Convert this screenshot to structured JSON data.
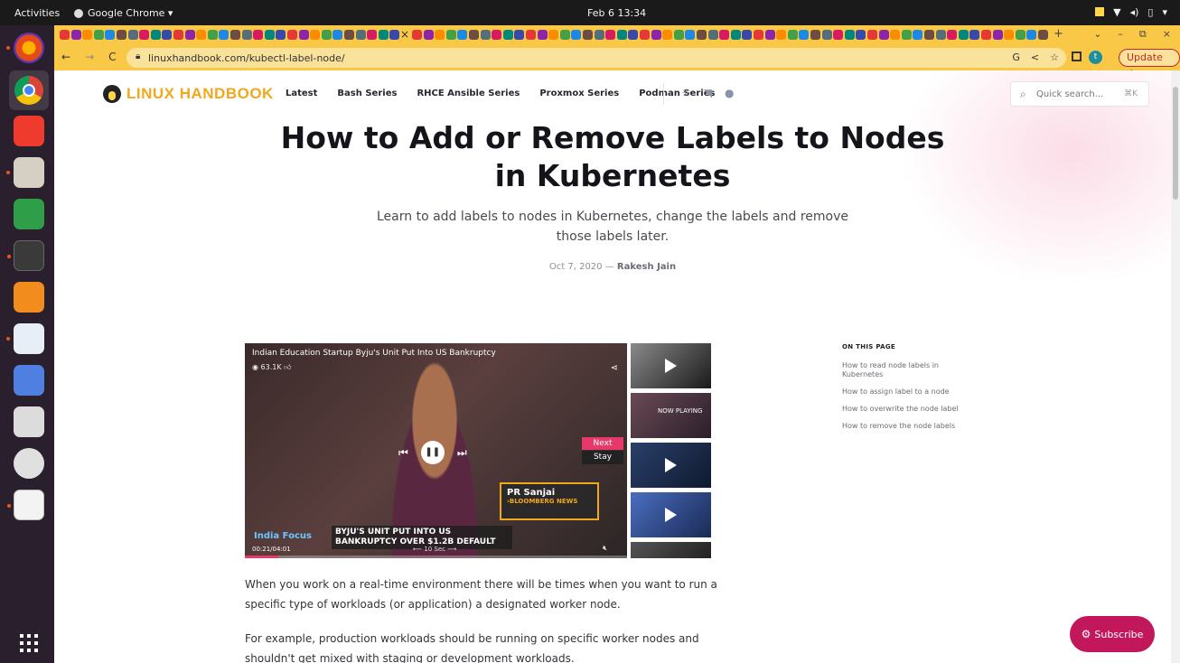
{
  "system_bar": {
    "activities": "Activities",
    "app_name": "Google Chrome ▾",
    "clock": "Feb 6  13:34",
    "tray_icons": [
      "wifi-icon",
      "volume-icon",
      "battery-icon",
      "power-menu-icon"
    ]
  },
  "dock": {
    "apps": [
      "firefox-icon",
      "chrome-icon",
      "anydesk-icon",
      "files-icon",
      "spreadsheet-icon",
      "terminal-icon",
      "sublime-icon",
      "text-editor-icon",
      "screenshot-icon",
      "image-viewer-icon",
      "software-updater-icon",
      "document-viewer-icon"
    ],
    "show_apps": "show-apps-icon"
  },
  "browser": {
    "tab_close": "×",
    "new_tab": "+",
    "window_controls": [
      "⌄",
      "–",
      "⧉",
      "×"
    ],
    "url": "linuxhandbook.com/kubectl-label-node/",
    "profile_initial": "t",
    "update_label": "Update",
    "update_menu": "⋮",
    "colors": {
      "toolbar": "#f9c846",
      "omnibox": "#fbe29a",
      "update": "#c62828"
    }
  },
  "site": {
    "brand": "LINUX HANDBOOK",
    "nav": [
      "Latest",
      "Bash Series",
      "RHCE Ansible Series",
      "Proxmox Series",
      "Podman Series"
    ],
    "social_icons": [
      "theme-toggle-icon",
      "twitter-icon",
      "facebook-icon"
    ],
    "search_placeholder": "Quick search...",
    "search_shortcut": "⌘K",
    "colors": {
      "brand": "#f0a81c",
      "accent": "#c2185b"
    }
  },
  "article": {
    "title": "How to Add or Remove Labels to Nodes in Kubernetes",
    "subtitle": "Learn to add labels to nodes in Kubernetes, change the labels and remove those labels later.",
    "date": "Oct 7, 2020",
    "separator": "—",
    "author": "Rakesh Jain",
    "paragraphs": [
      "When you work on a real-time environment there will be times when you want to run a specific type of workloads (or application) a designated worker node.",
      "For example, production workloads should be running on specific worker nodes and shouldn't get mixed with staging or development workloads."
    ]
  },
  "video": {
    "title": "Indian Education Startup Byju's Unit Put Into US Bankruptcy",
    "views": "◉ 63.1K",
    "next_label": "Next",
    "stay_label": "Stay",
    "lower_third_name": "PR Sanjai",
    "lower_third_org": "›BLOOMBERG NEWS",
    "ticker": "BYJU'S UNIT PUT INTO US BANKRUPTCY OVER $1.2B DEFAULT",
    "show_brand": "India Focus",
    "time": "00:21/04:01",
    "skip": "⟵ 10 Sec ⟶",
    "progress_fraction": 0.087,
    "thumb_now_playing": "NOW PLAYING"
  },
  "toc": {
    "heading": "ON THIS PAGE",
    "items": [
      "How to read node labels in Kubernetes",
      "How to assign label to a node",
      "How to overwrite the node label",
      "How to remove the node labels"
    ]
  },
  "subscribe": {
    "label": "Subscribe"
  }
}
